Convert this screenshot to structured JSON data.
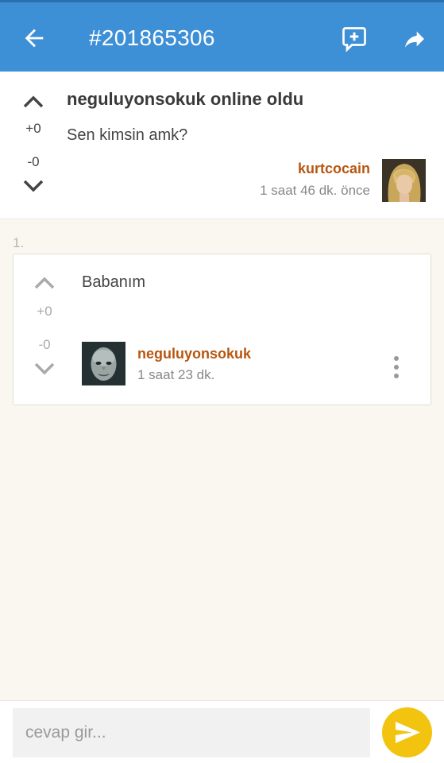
{
  "appbar": {
    "title": "#201865306",
    "back_icon": "arrow-back-icon",
    "add_comment_icon": "add-comment-icon",
    "share_icon": "share-icon",
    "color": "#3d8fd6"
  },
  "post": {
    "headline": "neguluyonsokuk online oldu",
    "body": "Sen kimsin amk?",
    "score_up": "+0",
    "score_down": "-0",
    "author": "kurtcocain",
    "time": "1 saat 46 dk. önce"
  },
  "comments": [
    {
      "index": "1.",
      "text": "Babanım",
      "score_up": "+0",
      "score_down": "-0",
      "author": "neguluyonsokuk",
      "time": "1 saat 23 dk."
    }
  ],
  "composer": {
    "placeholder": "cevap gir...",
    "send_icon": "send-icon",
    "send_color": "#f2c40f"
  },
  "colors": {
    "author": "#b8560f",
    "background": "#faf7f0"
  }
}
